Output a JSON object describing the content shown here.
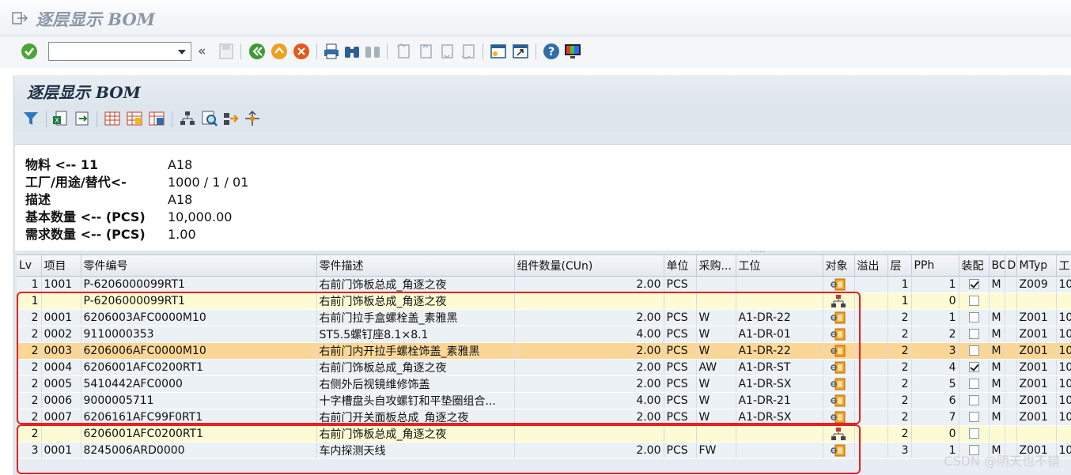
{
  "window": {
    "title": "逐层显示 BOM"
  },
  "command_field": {
    "value": ""
  },
  "panel": {
    "title": "逐层显示 BOM"
  },
  "header": {
    "rows": [
      {
        "label": "物料 <-- 11",
        "value": "A18"
      },
      {
        "label": "工厂/用途/替代<-",
        "value": "1000 / 1 / 01"
      },
      {
        "label": "描述",
        "value": "A18"
      },
      {
        "label": "基本数量 <-- (PCS)",
        "value": "10,000.00"
      },
      {
        "label": "需求数量 <-- (PCS)",
        "value": "1.00"
      }
    ],
    "splitter": "....."
  },
  "grid": {
    "columns": [
      "Lv",
      "项目",
      "零件编号",
      "零件描述",
      "组件数量(CUn)",
      "单位",
      "采购...",
      "工位",
      "对象",
      "溢出",
      "层",
      "PPh",
      "装配",
      "BC",
      "DI",
      "MTyp",
      "工"
    ],
    "rows": [
      {
        "lv": "1",
        "item": "1001",
        "part": "P-6206000099RT1",
        "desc": "右前门饰板总成_角逐之夜",
        "qty": "2.00",
        "unit": "PCS",
        "proc": "",
        "station": "",
        "obj": "material",
        "layer": "1",
        "pph": "1",
        "asm": true,
        "bc": "M",
        "mtyp": "Z009",
        "extra": "10",
        "style": "normal"
      },
      {
        "lv": "1",
        "item": "",
        "part": "P-6206000099RT1",
        "desc": "右前门饰板总成_角逐之夜",
        "qty": "",
        "unit": "",
        "proc": "",
        "station": "",
        "obj": "structure",
        "layer": "1",
        "pph": "0",
        "asm": false,
        "bc": "",
        "mtyp": "",
        "extra": "",
        "style": "yellow"
      },
      {
        "lv": "2",
        "item": "0001",
        "part": "6206003AFC0000M10",
        "desc": "右前门拉手盒螺栓盖_素雅黑",
        "qty": "2.00",
        "unit": "PCS",
        "proc": "W",
        "station": "A1-DR-22",
        "obj": "material",
        "layer": "2",
        "pph": "1",
        "asm": false,
        "bc": "M",
        "mtyp": "Z001",
        "extra": "10",
        "style": "normal"
      },
      {
        "lv": "2",
        "item": "0002",
        "part": "9110000353",
        "desc": "ST5.5螺钉座8.1×8.1",
        "qty": "4.00",
        "unit": "PCS",
        "proc": "W",
        "station": "A1-DR-01",
        "obj": "material",
        "layer": "2",
        "pph": "2",
        "asm": false,
        "bc": "M",
        "mtyp": "Z001",
        "extra": "10",
        "style": "normal"
      },
      {
        "lv": "2",
        "item": "0003",
        "part": "6206006AFC0000M10",
        "desc": "右前门内开拉手螺栓饰盖_素雅黑",
        "qty": "2.00",
        "unit": "PCS",
        "proc": "W",
        "station": "A1-DR-22",
        "obj": "material",
        "layer": "2",
        "pph": "3",
        "asm": false,
        "bc": "M",
        "mtyp": "Z001",
        "extra": "10",
        "style": "sel"
      },
      {
        "lv": "2",
        "item": "0004",
        "part": "6206001AFC0200RT1",
        "desc": "右前门饰板总成_角逐之夜",
        "qty": "2.00",
        "unit": "PCS",
        "proc": "AW",
        "station": "A1-DR-ST",
        "obj": "material",
        "layer": "2",
        "pph": "4",
        "asm": true,
        "bc": "M",
        "mtyp": "Z001",
        "extra": "10",
        "style": "normal"
      },
      {
        "lv": "2",
        "item": "0005",
        "part": "5410442AFC0000",
        "desc": "右侧外后视镜维修饰盖",
        "qty": "2.00",
        "unit": "PCS",
        "proc": "W",
        "station": "A1-DR-SX",
        "obj": "material",
        "layer": "2",
        "pph": "5",
        "asm": false,
        "bc": "M",
        "mtyp": "Z001",
        "extra": "10",
        "style": "normal"
      },
      {
        "lv": "2",
        "item": "0006",
        "part": "9000005711",
        "desc": "十字槽盘头自攻螺钉和平垫圈组合...",
        "qty": "4.00",
        "unit": "PCS",
        "proc": "W",
        "station": "A1-DR-21",
        "obj": "material",
        "layer": "2",
        "pph": "6",
        "asm": false,
        "bc": "M",
        "mtyp": "Z001",
        "extra": "10",
        "style": "normal"
      },
      {
        "lv": "2",
        "item": "0007",
        "part": "6206161AFC99F0RT1",
        "desc": "右前门开关面板总成_角逐之夜",
        "qty": "2.00",
        "unit": "PCS",
        "proc": "W",
        "station": "A1-DR-SX",
        "obj": "material",
        "layer": "2",
        "pph": "7",
        "asm": false,
        "bc": "M",
        "mtyp": "Z001",
        "extra": "10",
        "style": "normal"
      },
      {
        "lv": "2",
        "item": "",
        "part": "6206001AFC0200RT1",
        "desc": "右前门饰板总成_角逐之夜",
        "qty": "",
        "unit": "",
        "proc": "",
        "station": "",
        "obj": "structure",
        "layer": "2",
        "pph": "0",
        "asm": false,
        "bc": "",
        "mtyp": "",
        "extra": "",
        "style": "yellow"
      },
      {
        "lv": "3",
        "item": "0001",
        "part": "8245006ARD0000",
        "desc": "车内探测天线",
        "qty": "2.00",
        "unit": "PCS",
        "proc": "FW",
        "station": "",
        "obj": "material",
        "layer": "3",
        "pph": "1",
        "asm": false,
        "bc": "M",
        "mtyp": "Z001",
        "extra": "10",
        "style": "normal"
      }
    ]
  },
  "colors": {
    "highlight_box": "#e52222",
    "selected_row": "#fbd797",
    "heading_row": "#fdfbd3"
  },
  "watermark": "CSDN @阴天也不错"
}
